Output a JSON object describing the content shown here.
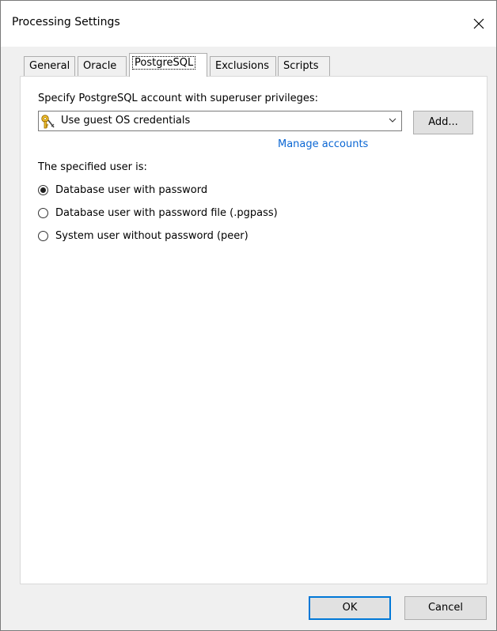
{
  "window": {
    "title": "Processing Settings"
  },
  "tabs": [
    {
      "label": "General"
    },
    {
      "label": "Oracle"
    },
    {
      "label": "PostgreSQL",
      "active": true
    },
    {
      "label": "Exclusions"
    },
    {
      "label": "Scripts"
    }
  ],
  "panel": {
    "account_label": "Specify PostgreSQL account with superuser privileges:",
    "account_selected": "Use guest OS credentials",
    "add_button": "Add...",
    "manage_link": "Manage accounts",
    "user_is_label": "The specified user is:",
    "options": [
      {
        "label": "Database user with password",
        "checked": true
      },
      {
        "label": "Database user with password file (.pgpass)",
        "checked": false
      },
      {
        "label": "System user without password (peer)",
        "checked": false
      }
    ]
  },
  "footer": {
    "ok_label": "OK",
    "cancel_label": "Cancel"
  },
  "colors": {
    "link": "#0a66d3",
    "default_button_border": "#0078d7"
  },
  "icons": {
    "close": "close-icon",
    "account": "key-icon",
    "dropdown": "chevron-down-icon"
  }
}
